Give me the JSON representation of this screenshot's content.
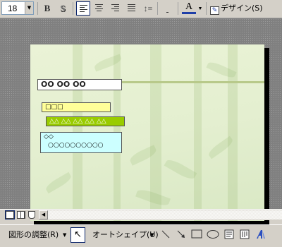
{
  "format_toolbar": {
    "font_size": "18",
    "bold_label": "B",
    "shadow_label": "S",
    "font_color_label": "A",
    "design_label": "デザイン(S)"
  },
  "slide": {
    "title_text": "OO OO OO",
    "box1_text": "□□□",
    "box2_text": "△△ △△ △△ △△ △△",
    "box3_line1": "◇◇",
    "box3_line2": "○○○○○○○○○○",
    "colors": {
      "background": "#e4efd0",
      "yellow_box": "#ffff99",
      "green_box": "#99cc00",
      "cyan_box": "#ccffff"
    }
  },
  "drawing_toolbar": {
    "adjust_label": "図形の調整(R)",
    "autoshape_label": "オートシェイプ(U)"
  },
  "icons": [
    "font-size-dropdown-icon",
    "bold-icon",
    "shadow-icon",
    "align-left-icon",
    "align-center-icon",
    "align-right-icon",
    "distribute-icon",
    "line-spacing-icon",
    "bullets-icon",
    "font-color-icon",
    "design-icon",
    "normal-view-icon",
    "slide-sorter-icon",
    "slideshow-icon",
    "scroll-left-icon",
    "select-cursor-icon",
    "line-icon",
    "arrow-icon",
    "rectangle-icon",
    "oval-icon",
    "textbox-icon",
    "vertical-textbox-icon",
    "wordart-icon"
  ]
}
